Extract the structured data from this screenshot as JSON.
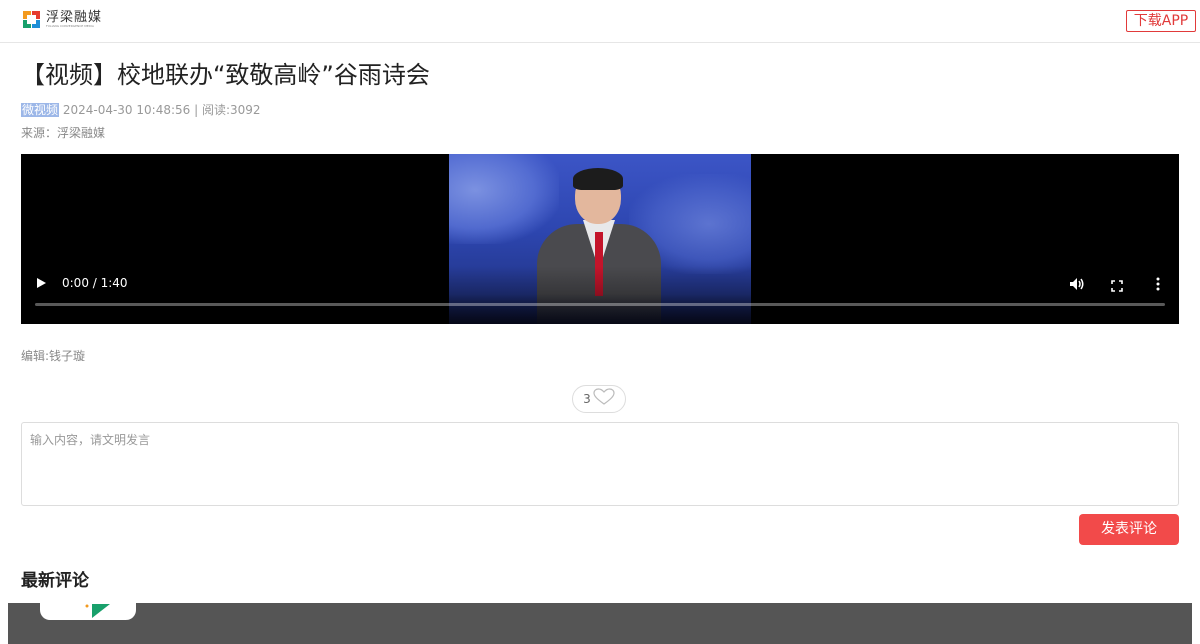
{
  "header": {
    "logo_text": "浮梁融媒",
    "logo_subtext": "FULIANG CONVERGENCE MEDIA",
    "download_label": "下载APP"
  },
  "article": {
    "title": "【视频】校地联办“致敬高岭”谷雨诗会",
    "tag": "微视频",
    "meta": " 2024-04-30 10:48:56 | 阅读:3092",
    "source": "来源：浮梁融媒",
    "editor": "编辑:钱子璇"
  },
  "video": {
    "time": "0:00 / 1:40",
    "progress": 0
  },
  "like": {
    "count": "3"
  },
  "comment": {
    "placeholder": "输入内容，请文明发言",
    "submit_label": "发表评论"
  },
  "latest_comments": {
    "heading": "最新评论"
  },
  "colors": {
    "accent": "#f24a4a",
    "download_border": "#e13a3a",
    "tag_bg": "#9cb7e8",
    "footer_bg": "#555555"
  }
}
